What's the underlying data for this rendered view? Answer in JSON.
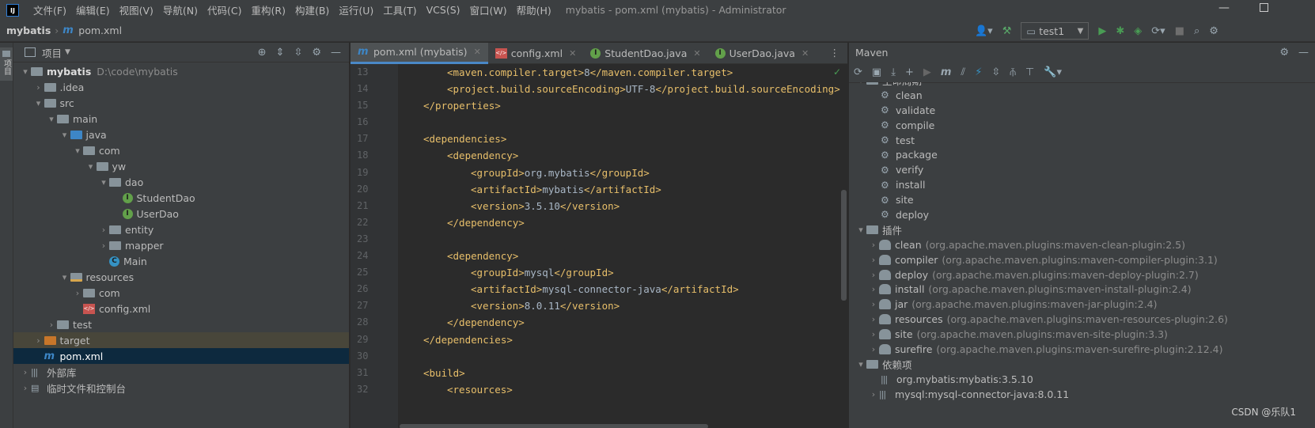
{
  "titlebar": {
    "logo": "IJ",
    "menu": [
      "文件(F)",
      "编辑(E)",
      "视图(V)",
      "导航(N)",
      "代码(C)",
      "重构(R)",
      "构建(B)",
      "运行(U)",
      "工具(T)",
      "VCS(S)",
      "窗口(W)",
      "帮助(H)"
    ],
    "title": "mybatis - pom.xml (mybatis) - Administrator"
  },
  "navbar": {
    "project": "mybatis",
    "file": "pom.xml",
    "run_config": "test1"
  },
  "sidebar_strip": {
    "label": "项目"
  },
  "project_panel": {
    "title": "项目",
    "tree": [
      {
        "label": "mybatis",
        "muted": "D:\\code\\mybatis",
        "indent": 0,
        "arrow": "▾",
        "icon": "folder",
        "bold": true
      },
      {
        "label": ".idea",
        "indent": 1,
        "arrow": "›",
        "icon": "folder"
      },
      {
        "label": "src",
        "indent": 1,
        "arrow": "▾",
        "icon": "folder"
      },
      {
        "label": "main",
        "indent": 2,
        "arrow": "▾",
        "icon": "folder"
      },
      {
        "label": "java",
        "indent": 3,
        "arrow": "▾",
        "icon": "folder-blue"
      },
      {
        "label": "com",
        "indent": 4,
        "arrow": "▾",
        "icon": "folder"
      },
      {
        "label": "yw",
        "indent": 5,
        "arrow": "▾",
        "icon": "folder"
      },
      {
        "label": "dao",
        "indent": 6,
        "arrow": "▾",
        "icon": "folder"
      },
      {
        "label": "StudentDao",
        "indent": 7,
        "arrow": "",
        "icon": "interface"
      },
      {
        "label": "UserDao",
        "indent": 7,
        "arrow": "",
        "icon": "interface"
      },
      {
        "label": "entity",
        "indent": 6,
        "arrow": "›",
        "icon": "folder"
      },
      {
        "label": "mapper",
        "indent": 6,
        "arrow": "›",
        "icon": "folder"
      },
      {
        "label": "Main",
        "indent": 6,
        "arrow": "",
        "icon": "class"
      },
      {
        "label": "resources",
        "indent": 3,
        "arrow": "▾",
        "icon": "folder-res"
      },
      {
        "label": "com",
        "indent": 4,
        "arrow": "›",
        "icon": "folder"
      },
      {
        "label": "config.xml",
        "indent": 4,
        "arrow": "",
        "icon": "xml"
      },
      {
        "label": "test",
        "indent": 2,
        "arrow": "›",
        "icon": "folder"
      },
      {
        "label": "target",
        "indent": 1,
        "arrow": "›",
        "icon": "folder-orange",
        "highlight": "target"
      },
      {
        "label": "pom.xml",
        "indent": 1,
        "arrow": "",
        "icon": "maven",
        "highlight": "selected"
      },
      {
        "label": "外部库",
        "indent": 0,
        "arrow": "›",
        "icon": "libraries"
      },
      {
        "label": "临时文件和控制台",
        "indent": 0,
        "arrow": "›",
        "icon": "scratches"
      }
    ]
  },
  "editor": {
    "tabs": [
      {
        "label": "pom.xml (mybatis)",
        "icon": "maven",
        "active": true
      },
      {
        "label": "config.xml",
        "icon": "xml"
      },
      {
        "label": "StudentDao.java",
        "icon": "interface"
      },
      {
        "label": "UserDao.java",
        "icon": "interface"
      }
    ],
    "lines": [
      {
        "n": "13",
        "indent": 2,
        "parts": [
          [
            "t",
            "<maven.compiler.target>"
          ],
          [
            "v",
            "8"
          ],
          [
            "t",
            "</maven.compiler.target>"
          ]
        ]
      },
      {
        "n": "14",
        "indent": 2,
        "parts": [
          [
            "t",
            "<project.build.sourceEncoding>"
          ],
          [
            "v",
            "UTF-8"
          ],
          [
            "t",
            "</project.build.sourceEncoding>"
          ]
        ]
      },
      {
        "n": "15",
        "indent": 1,
        "parts": [
          [
            "t",
            "</properties>"
          ]
        ]
      },
      {
        "n": "16",
        "indent": 0,
        "parts": []
      },
      {
        "n": "17",
        "indent": 1,
        "parts": [
          [
            "t",
            "<dependencies>"
          ]
        ]
      },
      {
        "n": "18",
        "indent": 2,
        "parts": [
          [
            "t",
            "<dependency>"
          ]
        ]
      },
      {
        "n": "19",
        "indent": 3,
        "parts": [
          [
            "t",
            "<groupId>"
          ],
          [
            "v",
            "org.mybatis"
          ],
          [
            "t",
            "</groupId>"
          ]
        ]
      },
      {
        "n": "20",
        "indent": 3,
        "parts": [
          [
            "t",
            "<artifactId>"
          ],
          [
            "v",
            "mybatis"
          ],
          [
            "t",
            "</artifactId>"
          ]
        ]
      },
      {
        "n": "21",
        "indent": 3,
        "parts": [
          [
            "t",
            "<version>"
          ],
          [
            "v",
            "3.5.10"
          ],
          [
            "t",
            "</version>"
          ]
        ]
      },
      {
        "n": "22",
        "indent": 2,
        "parts": [
          [
            "t",
            "</dependency>"
          ]
        ]
      },
      {
        "n": "23",
        "indent": 0,
        "parts": []
      },
      {
        "n": "24",
        "indent": 2,
        "parts": [
          [
            "t",
            "<dependency>"
          ]
        ]
      },
      {
        "n": "25",
        "indent": 3,
        "parts": [
          [
            "t",
            "<groupId>"
          ],
          [
            "v",
            "mysql"
          ],
          [
            "t",
            "</groupId>"
          ]
        ]
      },
      {
        "n": "26",
        "indent": 3,
        "parts": [
          [
            "t",
            "<artifactId>"
          ],
          [
            "v",
            "mysql-connector-java"
          ],
          [
            "t",
            "</artifactId>"
          ]
        ]
      },
      {
        "n": "27",
        "indent": 3,
        "parts": [
          [
            "t",
            "<version>"
          ],
          [
            "v",
            "8.0.11"
          ],
          [
            "t",
            "</version>"
          ]
        ]
      },
      {
        "n": "28",
        "indent": 2,
        "parts": [
          [
            "t",
            "</dependency>"
          ]
        ]
      },
      {
        "n": "29",
        "indent": 1,
        "parts": [
          [
            "t",
            "</dependencies>"
          ]
        ]
      },
      {
        "n": "30",
        "indent": 0,
        "parts": []
      },
      {
        "n": "31",
        "indent": 1,
        "parts": [
          [
            "t",
            "<build>"
          ]
        ]
      },
      {
        "n": "32",
        "indent": 2,
        "parts": [
          [
            "t",
            "<resources>"
          ]
        ]
      }
    ]
  },
  "maven": {
    "title": "Maven",
    "lifecycle_label": "生命周期",
    "lifecycle": [
      "clean",
      "validate",
      "compile",
      "test",
      "package",
      "verify",
      "install",
      "site",
      "deploy"
    ],
    "plugins_label": "插件",
    "plugins": [
      {
        "name": "clean",
        "detail": "(org.apache.maven.plugins:maven-clean-plugin:2.5)"
      },
      {
        "name": "compiler",
        "detail": "(org.apache.maven.plugins:maven-compiler-plugin:3.1)"
      },
      {
        "name": "deploy",
        "detail": "(org.apache.maven.plugins:maven-deploy-plugin:2.7)"
      },
      {
        "name": "install",
        "detail": "(org.apache.maven.plugins:maven-install-plugin:2.4)"
      },
      {
        "name": "jar",
        "detail": "(org.apache.maven.plugins:maven-jar-plugin:2.4)"
      },
      {
        "name": "resources",
        "detail": "(org.apache.maven.plugins:maven-resources-plugin:2.6)"
      },
      {
        "name": "site",
        "detail": "(org.apache.maven.plugins:maven-site-plugin:3.3)"
      },
      {
        "name": "surefire",
        "detail": "(org.apache.maven.plugins:maven-surefire-plugin:2.12.4)"
      }
    ],
    "deps_label": "依赖项",
    "deps": [
      "org.mybatis:mybatis:3.5.10",
      "mysql:mysql-connector-java:8.0.11"
    ]
  },
  "watermark": "CSDN @乐队1",
  "colors": {
    "tag": "#e8bf6a",
    "text": "#a9b7c6",
    "accent": "#4a88c7",
    "selected_row": "#0d293e",
    "target_row": "#48463a"
  }
}
